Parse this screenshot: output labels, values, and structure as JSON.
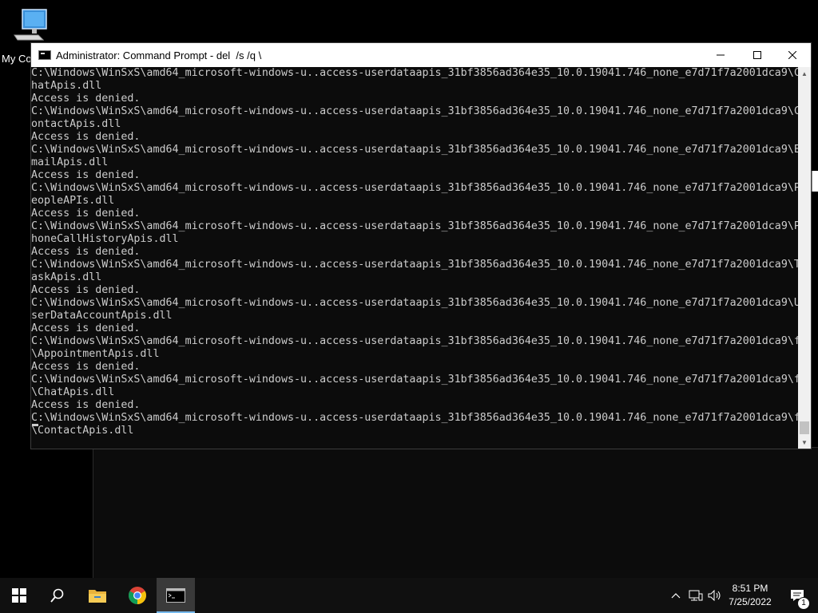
{
  "desktop": {
    "icon_label": "My Co"
  },
  "window": {
    "title": "Administrator: Command Prompt - del  /s /q \\"
  },
  "console": {
    "lines": [
      "C:\\Windows\\WinSxS\\amd64_microsoft-windows-u..access-userdataapis_31bf3856ad364e35_10.0.19041.746_none_e7d71f7a2001dca9\\C",
      "hatApis.dll",
      "Access is denied.",
      "C:\\Windows\\WinSxS\\amd64_microsoft-windows-u..access-userdataapis_31bf3856ad364e35_10.0.19041.746_none_e7d71f7a2001dca9\\C",
      "ontactApis.dll",
      "Access is denied.",
      "C:\\Windows\\WinSxS\\amd64_microsoft-windows-u..access-userdataapis_31bf3856ad364e35_10.0.19041.746_none_e7d71f7a2001dca9\\E",
      "mailApis.dll",
      "Access is denied.",
      "C:\\Windows\\WinSxS\\amd64_microsoft-windows-u..access-userdataapis_31bf3856ad364e35_10.0.19041.746_none_e7d71f7a2001dca9\\P",
      "eopleAPIs.dll",
      "Access is denied.",
      "C:\\Windows\\WinSxS\\amd64_microsoft-windows-u..access-userdataapis_31bf3856ad364e35_10.0.19041.746_none_e7d71f7a2001dca9\\P",
      "honeCallHistoryApis.dll",
      "Access is denied.",
      "C:\\Windows\\WinSxS\\amd64_microsoft-windows-u..access-userdataapis_31bf3856ad364e35_10.0.19041.746_none_e7d71f7a2001dca9\\T",
      "askApis.dll",
      "Access is denied.",
      "C:\\Windows\\WinSxS\\amd64_microsoft-windows-u..access-userdataapis_31bf3856ad364e35_10.0.19041.746_none_e7d71f7a2001dca9\\U",
      "serDataAccountApis.dll",
      "Access is denied.",
      "C:\\Windows\\WinSxS\\amd64_microsoft-windows-u..access-userdataapis_31bf3856ad364e35_10.0.19041.746_none_e7d71f7a2001dca9\\f",
      "\\AppointmentApis.dll",
      "Access is denied.",
      "C:\\Windows\\WinSxS\\amd64_microsoft-windows-u..access-userdataapis_31bf3856ad364e35_10.0.19041.746_none_e7d71f7a2001dca9\\f",
      "\\ChatApis.dll",
      "Access is denied.",
      "C:\\Windows\\WinSxS\\amd64_microsoft-windows-u..access-userdataapis_31bf3856ad364e35_10.0.19041.746_none_e7d71f7a2001dca9\\f",
      "\\ContactApis.dll"
    ]
  },
  "taskbar": {
    "apps": [
      "start-icon",
      "search-icon",
      "file-explorer-icon",
      "chrome-icon",
      "command-prompt-icon"
    ],
    "time": "8:51 PM",
    "date": "7/25/2022",
    "notification_count": "1",
    "accent": "#76b9ed"
  }
}
